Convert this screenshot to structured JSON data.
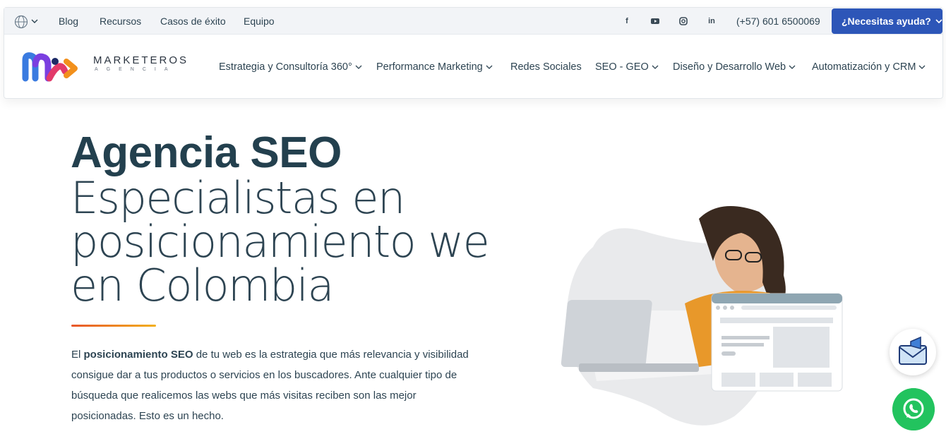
{
  "topbar": {
    "links": [
      "Blog",
      "Recursos",
      "Casos de éxito",
      "Equipo"
    ],
    "social": [
      "facebook-icon",
      "youtube-icon",
      "instagram-icon",
      "linkedin-icon"
    ],
    "phone": "(+57) 601 6500069",
    "help_button": "¿Necesitas ayuda?"
  },
  "logo": {
    "word": "MARKETEROS",
    "sub": "AGENCIA"
  },
  "nav": {
    "items": [
      {
        "label": "Estrategia y Consultoría 360°",
        "dropdown": true
      },
      {
        "label": "Performance Marketing",
        "dropdown": true
      },
      {
        "label": "Redes Sociales",
        "dropdown": false
      },
      {
        "label": "SEO - GEO",
        "dropdown": true
      },
      {
        "label": "Diseño y Desarrollo Web",
        "dropdown": true
      },
      {
        "label": "Automatización y CRM",
        "dropdown": true
      }
    ]
  },
  "hero": {
    "title": "Agencia SEO",
    "subtitle_lines": [
      "Especialistas en",
      "posicionamiento web",
      "en Colombia"
    ],
    "para_prefix": "El ",
    "para_bold": "posicionamiento SEO",
    "para_rest": " de tu web es la estrategia que más relevancia y visibilidad consigue dar a tus productos o servicios en los buscadores. Ante cualquier tipo de búsqueda que realicemos las webs que más visitas reciben son las mejor posicionadas. Esto es un hecho."
  },
  "colors": {
    "brand_blue": "#2d56b8",
    "title": "#23404e",
    "accent_orange": "#e8562a",
    "accent_yellow": "#f2b01c",
    "whatsapp": "#22c35e"
  }
}
